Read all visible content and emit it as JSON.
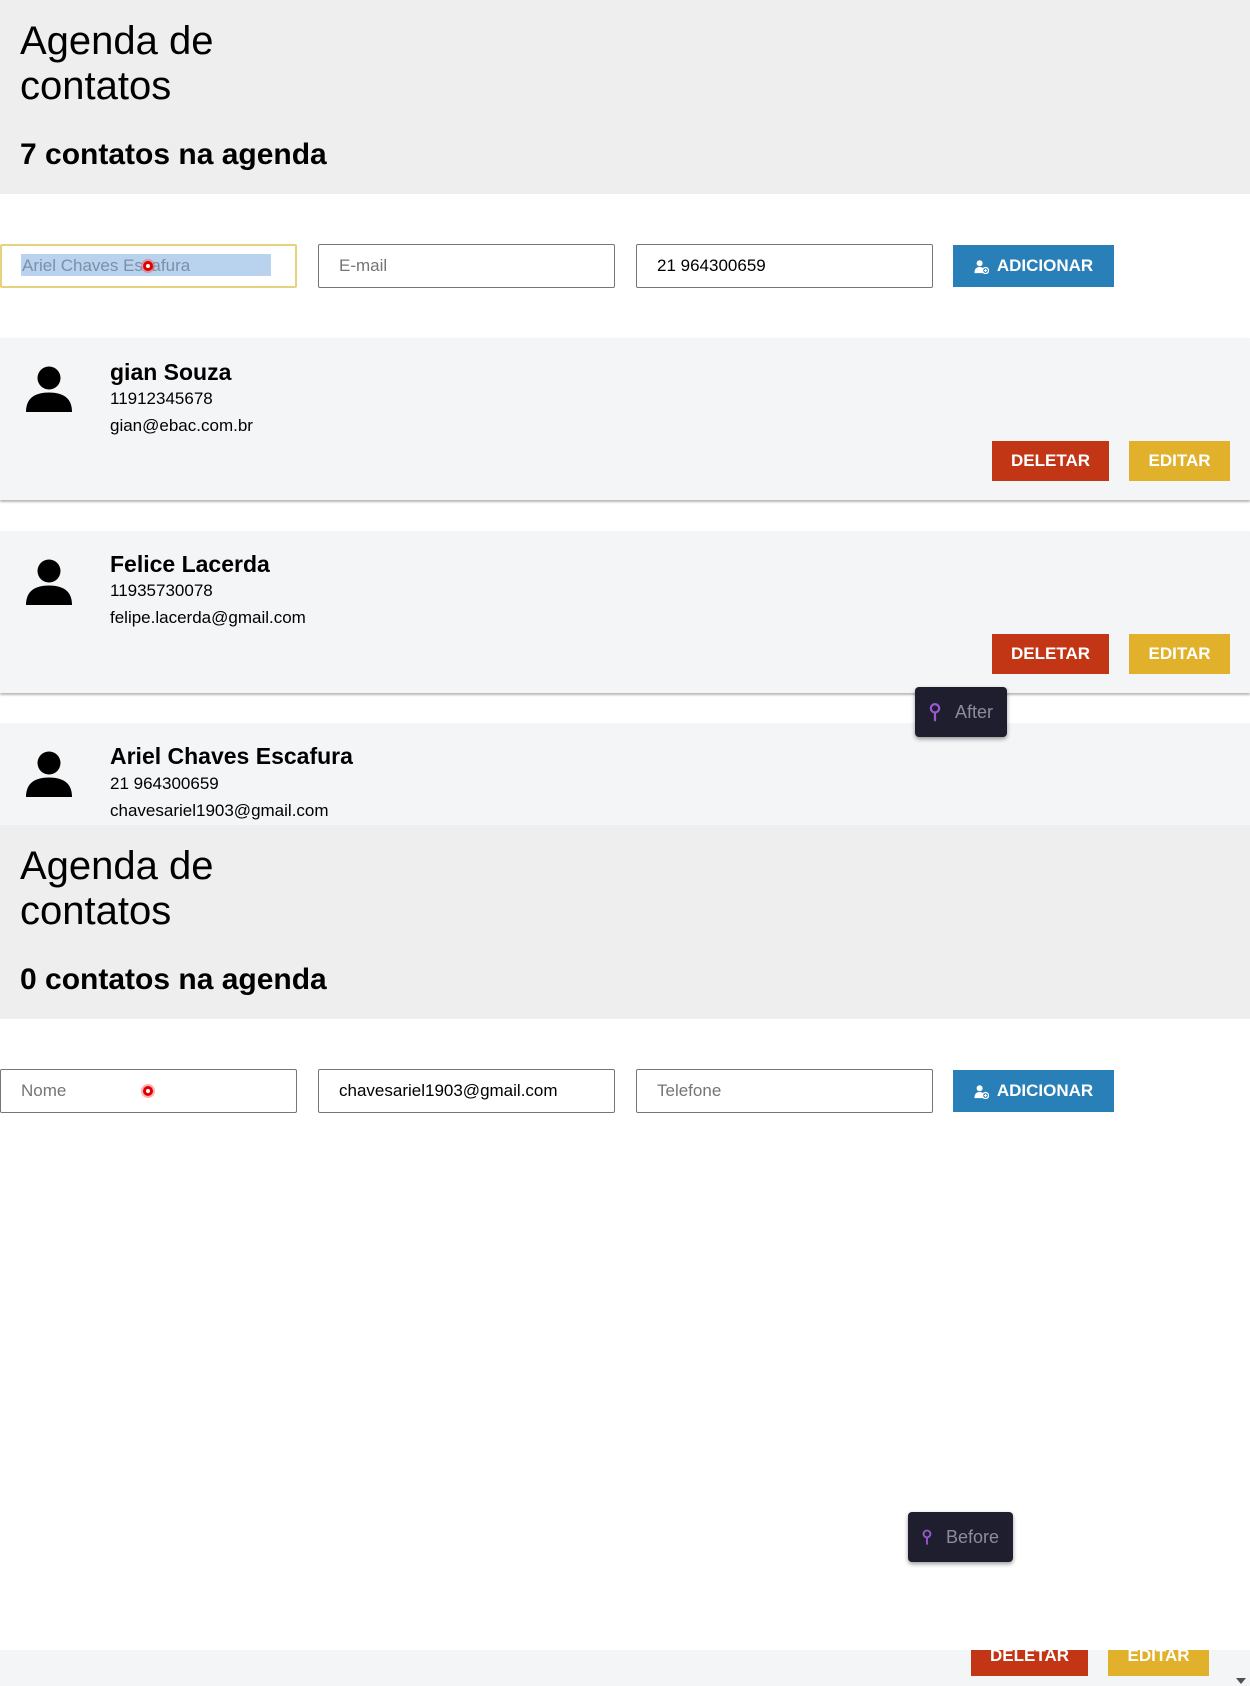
{
  "after": {
    "title": "Agenda de contatos",
    "count_text": "7 contatos na agenda",
    "form": {
      "name_value": "Ariel Chaves Escafura",
      "name_placeholder": "Nome",
      "email_value": "",
      "email_placeholder": "E-mail",
      "phone_value": "21 964300659",
      "phone_placeholder": "Telefone",
      "add_label": "ADICIONAR"
    },
    "contacts": [
      {
        "name": "gian Souza",
        "phone": "11912345678",
        "email": "gian@ebac.com.br"
      },
      {
        "name": "Felice Lacerda",
        "phone": "11935730078",
        "email": "felipe.lacerda@gmail.com"
      },
      {
        "name": "Ariel Chaves Escafura",
        "phone": "21 964300659",
        "email": "chavesariel1903@gmail.com"
      }
    ],
    "delete_label": "DELETAR",
    "edit_label": "EDITAR",
    "tag_label": "After"
  },
  "before": {
    "title": "Agenda de contatos",
    "count_text": "0 contatos na agenda",
    "form": {
      "name_value": "",
      "name_placeholder": "Nome",
      "email_value": "chavesariel1903@gmail.com",
      "email_placeholder": "E-mail",
      "phone_value": "",
      "phone_placeholder": "Telefone",
      "add_label": "ADICIONAR"
    },
    "delete_label": "DELETAR",
    "edit_label": "EDITAR",
    "tag_label": "Before"
  },
  "colors": {
    "header_bg": "#eeeeee",
    "card_bg": "#f4f5f7",
    "add_button": "#2980b9",
    "delete_button": "#c23616",
    "edit_button": "#e1b12c",
    "overlay_tag": "#1e1e2e",
    "pin_icon": "#9b59d0",
    "cursor": "#e00000"
  },
  "icons": [
    "add-user-icon",
    "user-avatar-icon",
    "pin-icon",
    "cursor-marker-icon",
    "scroll-down-arrow-icon"
  ]
}
